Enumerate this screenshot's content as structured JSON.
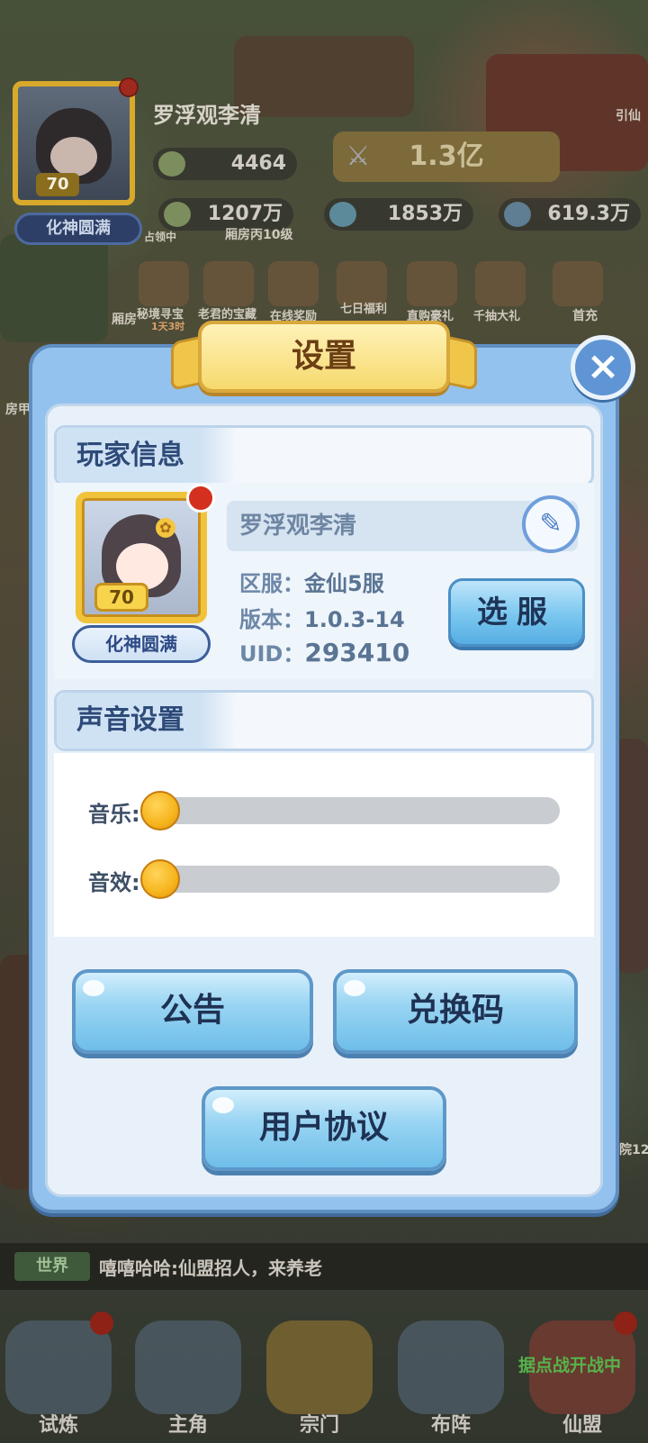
{
  "hud": {
    "player_name": "罗浮观李清",
    "level": "70",
    "rank": "化神圆满",
    "lingshi": "4464",
    "power": "1.3亿",
    "res1": "1207万",
    "res2": "1853万",
    "res3": "619.3万",
    "room_level": "厢房丙10级",
    "capture": "占领中",
    "guide": "引仙",
    "shortcuts": [
      "秘境寻宝",
      "老君的宝藏",
      "在线奖励",
      "七日福利",
      "直购豪礼",
      "千抽大礼",
      "首充"
    ],
    "countdown": "1天3时",
    "room_short": "厢房",
    "side_left": "房甲",
    "side_right": "院12"
  },
  "dialog": {
    "title": "设置",
    "close_icon": "close-icon",
    "player_section": "玩家信息",
    "name": "罗浮观李清",
    "level": "70",
    "rank": "化神圆满",
    "server_label": "区服：",
    "server_value": "金仙5服",
    "version_label": "版本：",
    "version_value": "1.0.3-14",
    "uid_label": "UID：",
    "uid_value": "293410",
    "select_server": "选服",
    "sound_section": "声音设置",
    "music_label": "音乐:",
    "music_level": 0,
    "sfx_label": "音效:",
    "sfx_level": 0,
    "notice_button": "公告",
    "redeem_button": "兑换码",
    "agreement_button": "用户协议"
  },
  "chat": {
    "channel": "世界",
    "message": "嘻嘻哈哈:仙盟招人，来养老"
  },
  "nav": {
    "items": [
      "试炼",
      "主角",
      "宗门",
      "布阵",
      "仙盟"
    ],
    "banner": "据点战开战中"
  },
  "colors": {
    "dialog_frame": "#93c2ef",
    "title_gold": "#f6d96d",
    "button_blue": "#6ebee9",
    "slider_knob": "#f6b41d"
  }
}
